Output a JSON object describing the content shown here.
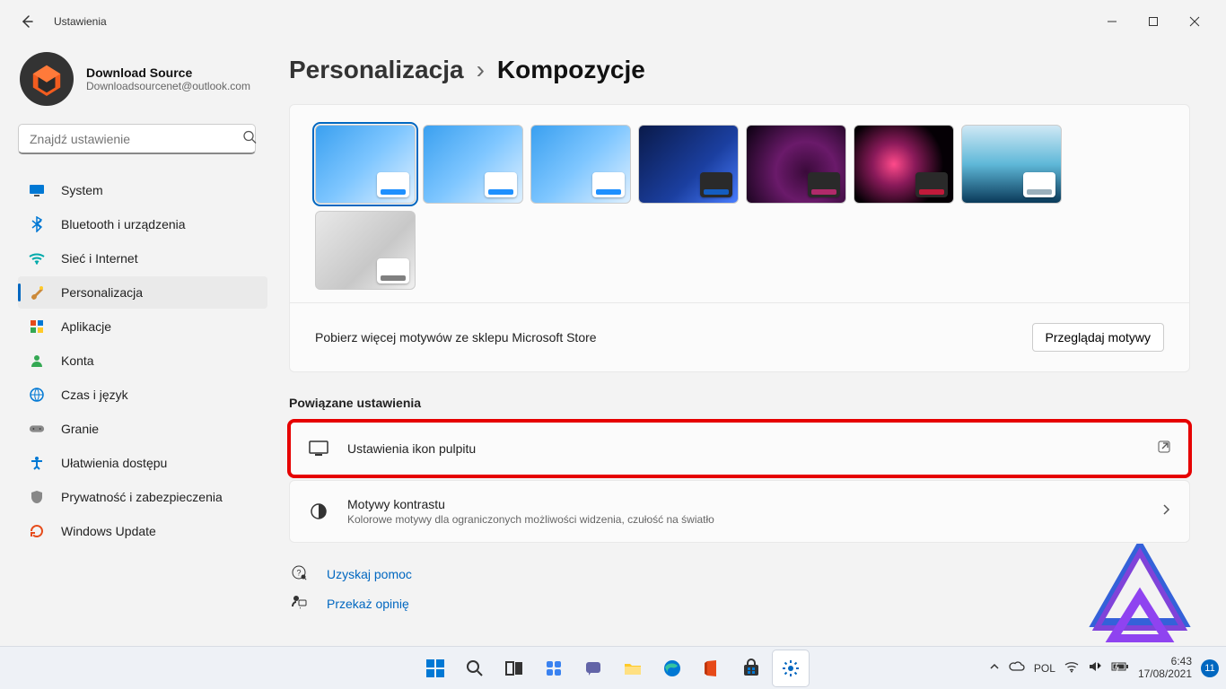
{
  "window": {
    "title": "Ustawienia"
  },
  "user": {
    "name": "Download Source",
    "email": "Downloadsourcenet@outlook.com"
  },
  "search": {
    "placeholder": "Znajdź ustawienie"
  },
  "nav": [
    {
      "label": "System",
      "icon": "display"
    },
    {
      "label": "Bluetooth i urządzenia",
      "icon": "bluetooth"
    },
    {
      "label": "Sieć i Internet",
      "icon": "wifi"
    },
    {
      "label": "Personalizacja",
      "icon": "brush",
      "active": true
    },
    {
      "label": "Aplikacje",
      "icon": "apps"
    },
    {
      "label": "Konta",
      "icon": "account"
    },
    {
      "label": "Czas i język",
      "icon": "globe"
    },
    {
      "label": "Granie",
      "icon": "gamepad"
    },
    {
      "label": "Ułatwienia dostępu",
      "icon": "accessibility"
    },
    {
      "label": "Prywatność i zabezpieczenia",
      "icon": "shield"
    },
    {
      "label": "Windows Update",
      "icon": "update"
    }
  ],
  "breadcrumb": {
    "parent": "Personalizacja",
    "current": "Kompozycje"
  },
  "themes": [
    {
      "bg": "bg-blue-light",
      "accent": "#1e90ff",
      "selected": true,
      "dark_win": false
    },
    {
      "bg": "bg-blue-light",
      "accent": "#1e90ff",
      "dark_win": false
    },
    {
      "bg": "bg-blue-light",
      "accent": "#1e90ff",
      "dark_win": false
    },
    {
      "bg": "bg-blue-dark",
      "accent": "#145dc0",
      "dark_win": true
    },
    {
      "bg": "bg-pink",
      "accent": "#b02a6a",
      "dark_win": true
    },
    {
      "bg": "bg-flower",
      "accent": "#c01a3a",
      "dark_win": true
    },
    {
      "bg": "bg-sea",
      "accent": "#9ab0bc",
      "dark_win": false
    },
    {
      "bg": "bg-grey",
      "accent": "#808080",
      "dark_win": false
    }
  ],
  "store": {
    "text": "Pobierz więcej motywów ze sklepu Microsoft Store",
    "button": "Przeglądaj motywy"
  },
  "section_title": "Powiązane ustawienia",
  "settings": [
    {
      "title": "Ustawienia ikon pulpitu",
      "desc": "",
      "icon": "desktop",
      "arrow": "external",
      "highlight": true
    },
    {
      "title": "Motywy kontrastu",
      "desc": "Kolorowe motywy dla ograniczonych możliwości widzenia, czułość na światło",
      "icon": "contrast",
      "arrow": "chevron"
    }
  ],
  "help": {
    "get_help": "Uzyskaj pomoc",
    "feedback": "Przekaż opinię"
  },
  "taskbar": {
    "lang": "POL",
    "time": "6:43",
    "date": "17/08/2021",
    "notif_count": "11"
  }
}
